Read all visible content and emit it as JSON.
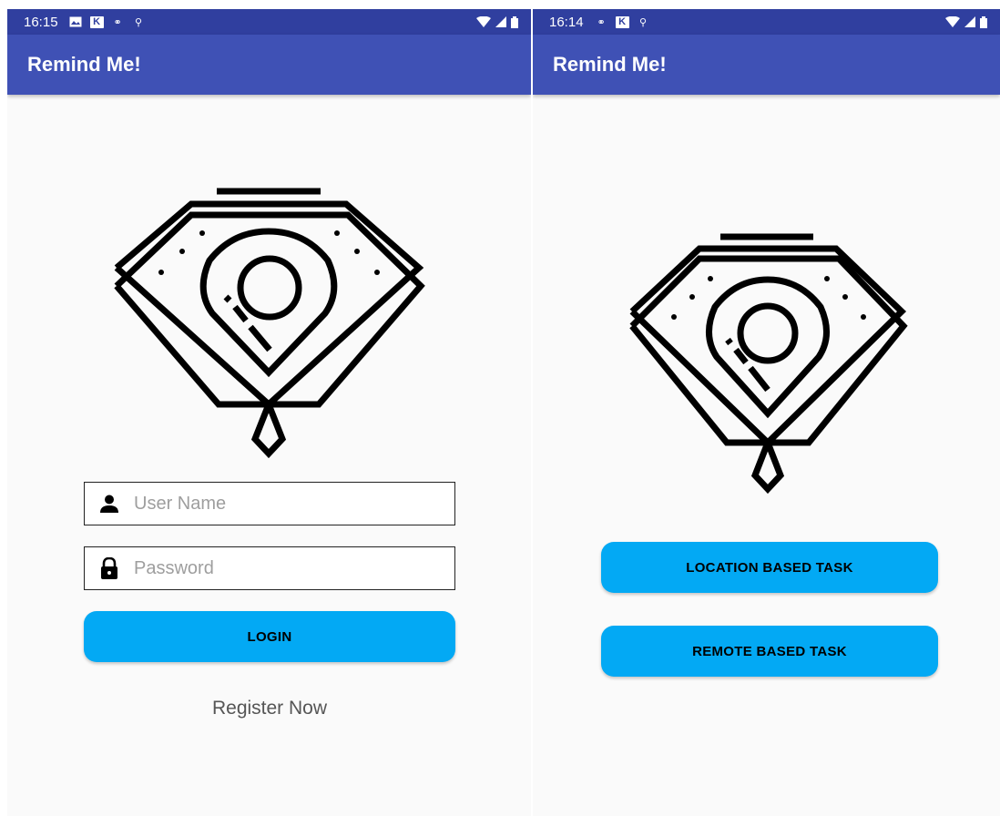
{
  "left_screen": {
    "status_bar": {
      "time": "16:15"
    },
    "app_bar": {
      "title": "Remind Me!"
    },
    "login_form": {
      "username": {
        "placeholder": "User Name",
        "value": "",
        "icon": "person-icon"
      },
      "password": {
        "placeholder": "Password",
        "value": "",
        "icon": "lock-icon"
      },
      "login_label": "LOGIN",
      "register_label": "Register Now"
    }
  },
  "right_screen": {
    "status_bar": {
      "time": "16:14"
    },
    "app_bar": {
      "title": "Remind Me!"
    },
    "actions": {
      "location_label": "LOCATION BASED TASK",
      "remote_label": "REMOTE BASED TASK"
    }
  },
  "colors": {
    "status_bar": "#303f9f",
    "app_bar": "#3f51b5",
    "button": "#03a9f4",
    "background": "#fafafa"
  }
}
